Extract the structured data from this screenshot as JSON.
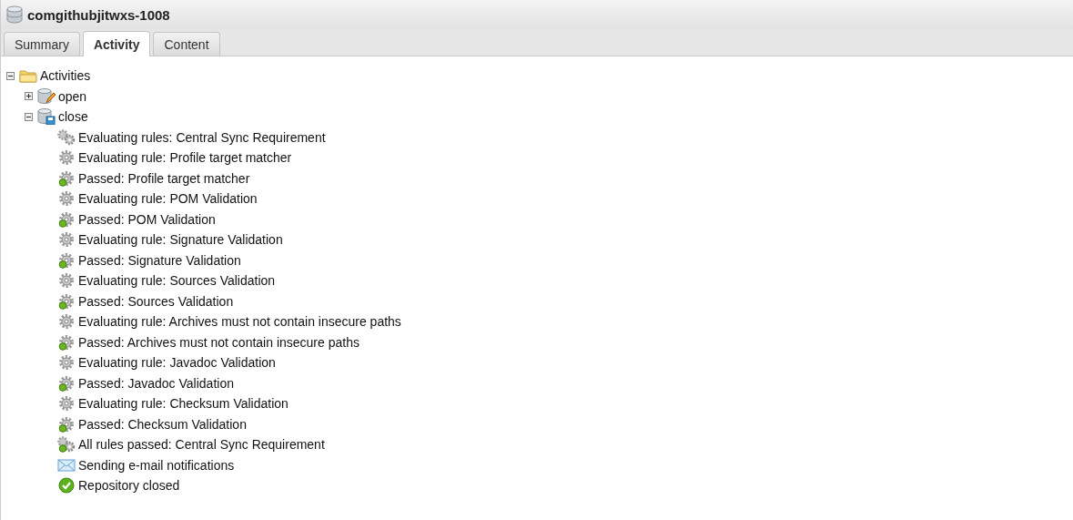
{
  "window": {
    "title": "comgithubjitwxs-1008"
  },
  "tabs": [
    {
      "label": "Summary",
      "selected": false
    },
    {
      "label": "Activity",
      "selected": true
    },
    {
      "label": "Content",
      "selected": false
    }
  ],
  "tree": {
    "label": "Activities",
    "kind": "folder",
    "expanded": true,
    "children": [
      {
        "label": "open",
        "kind": "repo-edit",
        "expanded": false
      },
      {
        "label": "close",
        "kind": "repo-closed",
        "expanded": true,
        "children": [
          {
            "label": "Evaluating rules: Central Sync Requirement",
            "kind": "gears"
          },
          {
            "label": "Evaluating rule: Profile target matcher",
            "kind": "gear"
          },
          {
            "label": "Passed: Profile target matcher",
            "kind": "gear-passed"
          },
          {
            "label": "Evaluating rule: POM Validation",
            "kind": "gear"
          },
          {
            "label": "Passed: POM Validation",
            "kind": "gear-passed"
          },
          {
            "label": "Evaluating rule: Signature Validation",
            "kind": "gear"
          },
          {
            "label": "Passed: Signature Validation",
            "kind": "gear-passed"
          },
          {
            "label": "Evaluating rule: Sources Validation",
            "kind": "gear"
          },
          {
            "label": "Passed: Sources Validation",
            "kind": "gear-passed"
          },
          {
            "label": "Evaluating rule: Archives must not contain insecure paths",
            "kind": "gear"
          },
          {
            "label": "Passed: Archives must not contain insecure paths",
            "kind": "gear-passed"
          },
          {
            "label": "Evaluating rule: Javadoc Validation",
            "kind": "gear"
          },
          {
            "label": "Passed: Javadoc Validation",
            "kind": "gear-passed"
          },
          {
            "label": "Evaluating rule: Checksum Validation",
            "kind": "gear"
          },
          {
            "label": "Passed: Checksum Validation",
            "kind": "gear-passed"
          },
          {
            "label": "All rules passed: Central Sync Requirement",
            "kind": "gears-passed"
          },
          {
            "label": "Sending e-mail notifications",
            "kind": "mail"
          },
          {
            "label": "Repository closed",
            "kind": "check"
          }
        ]
      }
    ]
  }
}
